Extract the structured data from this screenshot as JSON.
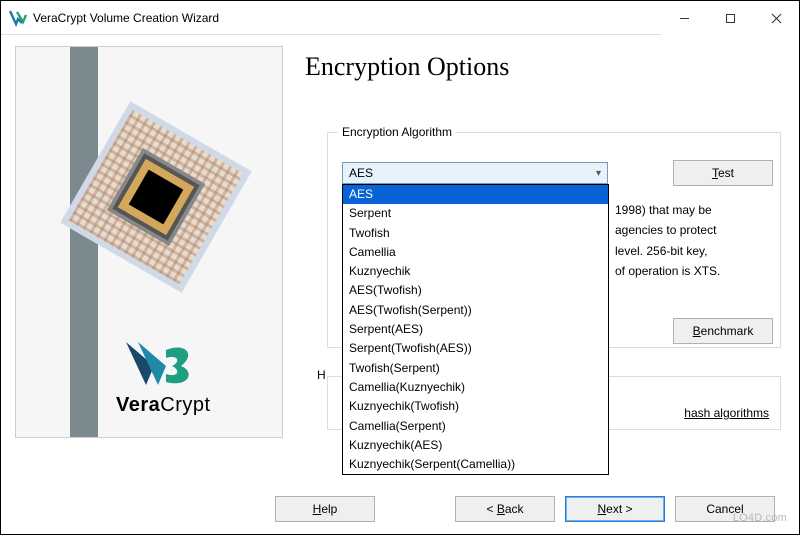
{
  "window": {
    "title": "VeraCrypt Volume Creation Wizard",
    "min": "—",
    "max": "□",
    "close": "✕"
  },
  "banner": {
    "brand_prefix": "Vera",
    "brand_suffix": "Crypt"
  },
  "page": {
    "title": "Encryption Options"
  },
  "encryption": {
    "group_label": "Encryption Algorithm",
    "selected": "AES",
    "options": [
      "AES",
      "Serpent",
      "Twofish",
      "Camellia",
      "Kuznyechik",
      "AES(Twofish)",
      "AES(Twofish(Serpent))",
      "Serpent(AES)",
      "Serpent(Twofish(AES))",
      "Twofish(Serpent)",
      "Camellia(Kuznyechik)",
      "Kuznyechik(Twofish)",
      "Camellia(Serpent)",
      "Kuznyechik(AES)",
      "Kuznyechik(Serpent(Camellia))"
    ],
    "test_label_pre": "",
    "test_underline": "T",
    "test_label_post": "est",
    "desc_peek_1": "1998) that may be",
    "desc_peek_2": "agencies to protect",
    "desc_peek_3": "level. 256-bit key,",
    "desc_peek_4": "of operation is XTS.",
    "benchmark_underline": "B",
    "benchmark_post": "enchmark"
  },
  "hash": {
    "label_prefix": "H",
    "link_text": "hash algorithms"
  },
  "footer": {
    "help_underline": "H",
    "help_post": "elp",
    "back_pre": "< ",
    "back_underline": "B",
    "back_post": "ack",
    "next_underline": "N",
    "next_post": "ext >",
    "cancel": "Cancel"
  },
  "watermark": "LO4D.com"
}
